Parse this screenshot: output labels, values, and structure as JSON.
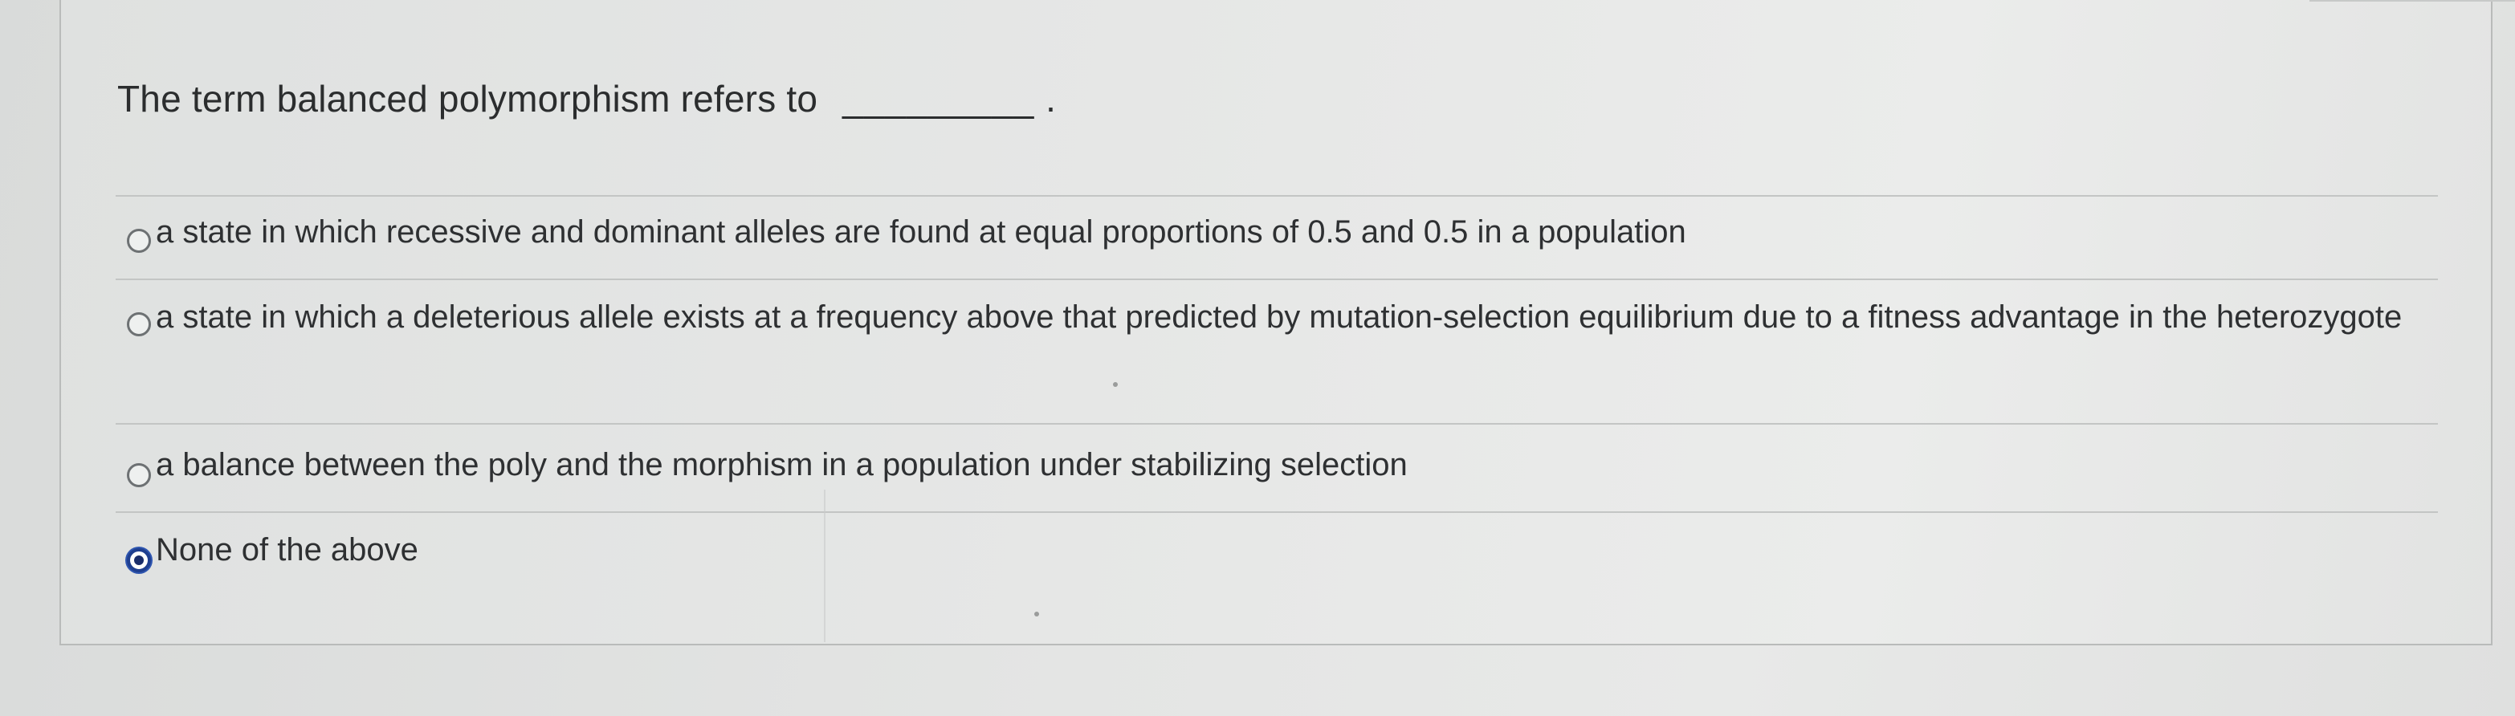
{
  "question": {
    "text": "The term balanced polymorphism refers to",
    "blank": "_________ ."
  },
  "options": [
    {
      "label": "a state in which recessive and dominant alleles are found at equal proportions of 0.5 and 0.5 in a population",
      "selected": false
    },
    {
      "label": "a state in which a deleterious allele exists at a frequency above that predicted by mutation-selection equilibrium due to a fitness advantage in the heterozygote",
      "selected": false
    },
    {
      "label": "a balance between the poly and the morphism in a population under stabilizing selection",
      "selected": false
    },
    {
      "label": "None of the above",
      "selected": true
    }
  ],
  "colors": {
    "selected_radio": "#1f3f8f",
    "text": "#2e3032",
    "divider": "#c3c5c4"
  },
  "icons": {
    "radio_unselected": "radio-empty-icon",
    "radio_selected": "radio-filled-icon"
  }
}
